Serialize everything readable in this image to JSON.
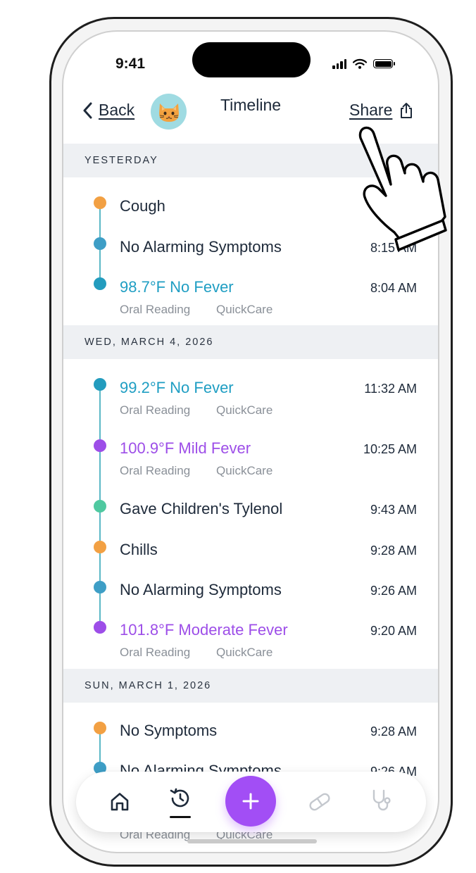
{
  "status_bar": {
    "time": "9:41"
  },
  "header": {
    "back_label": "Back",
    "title": "Timeline",
    "share_label": "Share"
  },
  "sections": [
    {
      "label": "YESTERDAY",
      "events": [
        {
          "title": "Cough",
          "time": "",
          "color": "#f2a043",
          "title_color": "#1e2a3a"
        },
        {
          "title": "No Alarming Symptoms",
          "time": "8:15 AM",
          "color": "#3e9ec6",
          "title_color": "#1e2a3a"
        },
        {
          "title": "98.7°F No Fever",
          "time": "8:04 AM",
          "color": "#239cbe",
          "title_color": "#1f9ec3",
          "sub1": "Oral Reading",
          "sub2": "QuickCare"
        }
      ]
    },
    {
      "label": "WED, MARCH 4, 2026",
      "events": [
        {
          "title": "99.2°F No Fever",
          "time": "11:32 AM",
          "color": "#239cbe",
          "title_color": "#1f9ec3",
          "sub1": "Oral Reading",
          "sub2": "QuickCare"
        },
        {
          "title": "100.9°F Mild Fever",
          "time": "10:25 AM",
          "color": "#9d4ee8",
          "title_color": "#9d4ee8",
          "sub1": "Oral Reading",
          "sub2": "QuickCare"
        },
        {
          "title": "Gave Children's Tylenol",
          "time": "9:43 AM",
          "color": "#4fc9a0",
          "title_color": "#1e2a3a"
        },
        {
          "title": "Chills",
          "time": "9:28 AM",
          "color": "#f2a043",
          "title_color": "#1e2a3a"
        },
        {
          "title": "No Alarming Symptoms",
          "time": "9:26 AM",
          "color": "#3e9ec6",
          "title_color": "#1e2a3a"
        },
        {
          "title": "101.8°F Moderate Fever",
          "time": "9:20 AM",
          "color": "#9d4ee8",
          "title_color": "#9d4ee8",
          "sub1": "Oral Reading",
          "sub2": "QuickCare"
        }
      ]
    },
    {
      "label": "SUN, MARCH 1, 2026",
      "events": [
        {
          "title": "No Symptoms",
          "time": "9:28 AM",
          "color": "#f2a043",
          "title_color": "#1e2a3a"
        },
        {
          "title": "No Alarming Symptoms",
          "time": "9:26 AM",
          "color": "#3e9ec6",
          "title_color": "#1e2a3a"
        }
      ],
      "peek_sub1": "Oral Reading",
      "peek_sub2": "QuickCare"
    }
  ],
  "bottom_nav": {
    "items": [
      {
        "icon": "home-icon"
      },
      {
        "icon": "history-icon",
        "active": true
      },
      {
        "icon": "add-icon",
        "label": "+"
      },
      {
        "icon": "pill-icon"
      },
      {
        "icon": "stethoscope-icon"
      }
    ],
    "accent": "#a24ef5"
  }
}
